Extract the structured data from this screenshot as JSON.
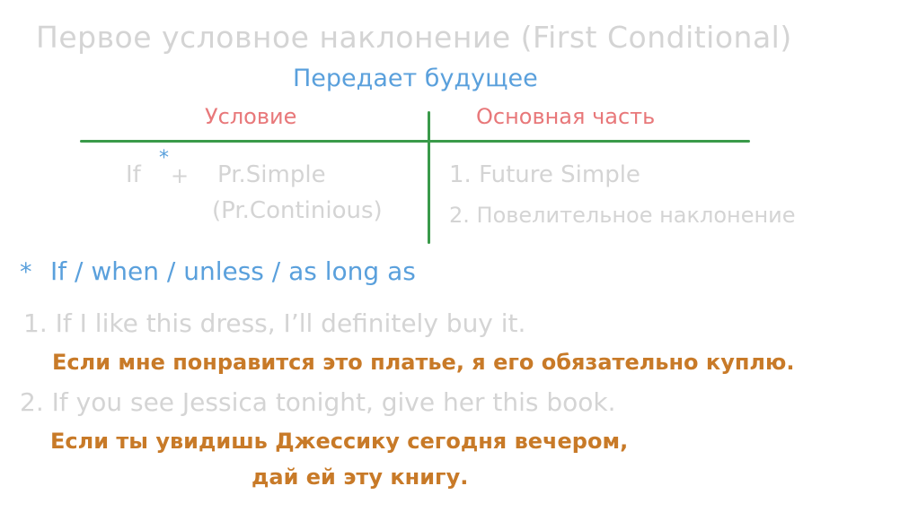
{
  "title": "Первое условное наклонение (First Conditional)",
  "subtitle": "Передает будущее",
  "table": {
    "left_header": "Условие",
    "right_header": "Основная часть",
    "left": {
      "if": "If",
      "star": "*",
      "plus": "+",
      "line1": "Pr.Simple",
      "line2": "(Pr.Continious)"
    },
    "right": {
      "line1": "1. Future Simple",
      "line2": "2. Повелительное наклонение"
    }
  },
  "note": {
    "star": "*",
    "text": "If / when / unless / as long as"
  },
  "examples": [
    {
      "en": "1. If I like this dress, I’ll definitely buy it.",
      "ru": [
        "Если мне понравится это платье, я его обязательно куплю."
      ]
    },
    {
      "en": "2. If you see Jessica tonight, give her this book.",
      "ru": [
        "Если ты увидишь Джессику сегодня вечером,",
        "дай ей эту книгу."
      ]
    }
  ],
  "colors": {
    "gray_text": "#d4d4d4",
    "blue_text": "#5aa0dc",
    "header_red": "#e8787a",
    "translation_orange": "#c87a28",
    "table_lines_green": "#3a9a4a"
  }
}
